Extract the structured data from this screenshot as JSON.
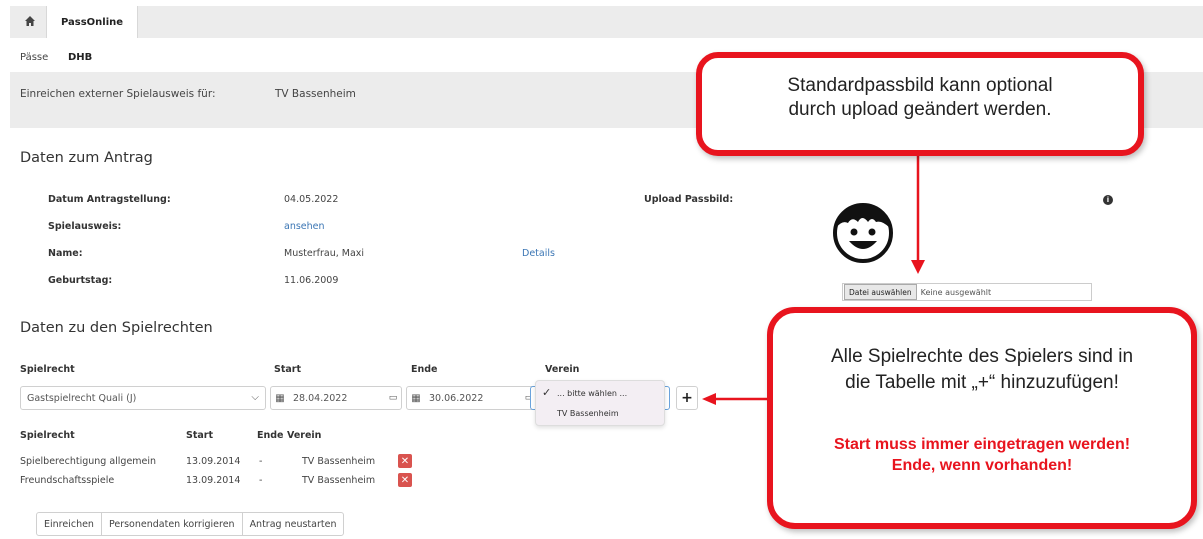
{
  "nav": {
    "tab_label": "PassOnline"
  },
  "breadcrumb": {
    "item1": "Pässe",
    "item2": "DHB"
  },
  "info": {
    "label": "Einreichen externer Spielausweis für:",
    "value": "TV Bassenheim"
  },
  "antrag": {
    "title": "Daten zum Antrag",
    "datum_label": "Datum Antragstellung:",
    "datum_value": "04.05.2022",
    "spielausweis_label": "Spielausweis:",
    "spielausweis_link": "ansehen",
    "name_label": "Name:",
    "name_value": "Musterfrau, Maxi",
    "details_link": "Details",
    "geburtstag_label": "Geburtstag:",
    "geburtstag_value": "11.06.2009",
    "upload_label": "Upload Passbild:",
    "file_button": "Datei auswählen",
    "file_status": "Keine ausgewählt"
  },
  "spielrechte": {
    "title": "Daten zu den Spielrechten",
    "col_spielrecht": "Spielrecht",
    "col_start": "Start",
    "col_ende": "Ende",
    "col_verein": "Verein",
    "select_value": "Gastspielrecht Quali (J)",
    "start_date": "28.04.2022",
    "end_date": "30.06.2022",
    "dropdown_options": [
      "... bitte wählen ...",
      "TV Bassenheim"
    ],
    "plus_label": "+",
    "table_headers": [
      "Spielrecht",
      "Start",
      "Ende",
      "Verein"
    ],
    "rows": [
      {
        "spielrecht": "Spielberechtigung allgemein",
        "start": "13.09.2014",
        "ende": "-",
        "verein": "TV Bassenheim"
      },
      {
        "spielrecht": "Freundschaftsspiele",
        "start": "13.09.2014",
        "ende": "-",
        "verein": "TV Bassenheim"
      }
    ]
  },
  "actions": {
    "einreichen": "Einreichen",
    "korrigieren": "Personendaten korrigieren",
    "neustarten": "Antrag neustarten"
  },
  "callouts": {
    "top_line1": "Standardpassbild kann optional",
    "top_line2": "durch upload geändert werden.",
    "bottom_line1": "Alle Spielrechte des Spielers sind in",
    "bottom_line2": "die Tabelle mit „+“ hinzuzufügen!",
    "bottom_warn1": "Start muss immer eingetragen werden!",
    "bottom_warn2": "Ende, wenn vorhanden!"
  },
  "colors": {
    "callout_red": "#e8141e",
    "link_blue": "#3b76b4",
    "delete_red": "#d9534f"
  }
}
